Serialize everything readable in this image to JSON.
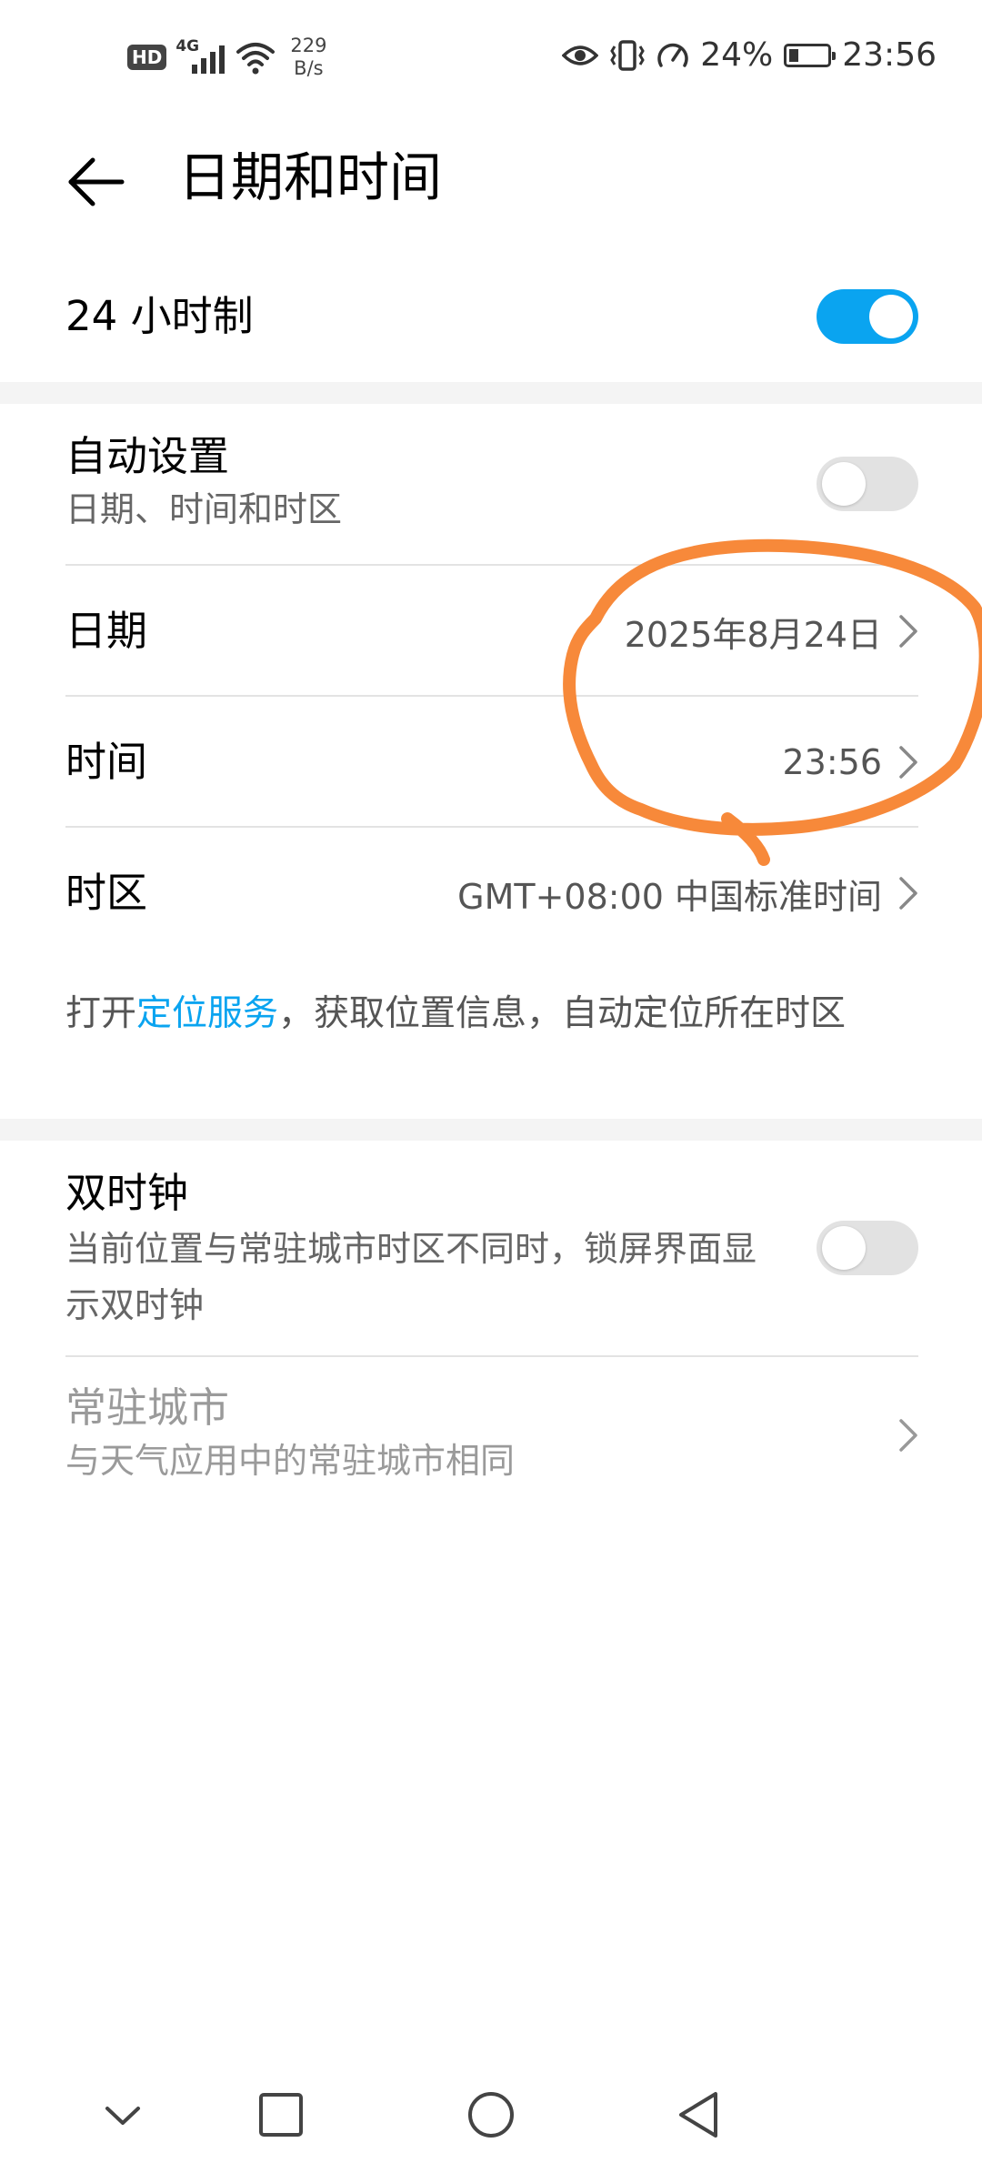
{
  "status_bar": {
    "hd": "HD",
    "network": "4G",
    "speed_value": "229",
    "speed_unit": "B/s",
    "battery_text": "24%",
    "battery_level": 0.24,
    "time": "23:56",
    "icons": [
      "eye-icon",
      "vibrate-icon",
      "speed-icon"
    ]
  },
  "header": {
    "title": "日期和时间"
  },
  "settings": {
    "hour24": {
      "label": "24 小时制",
      "enabled": true
    },
    "auto": {
      "label": "自动设置",
      "sub": "日期、时间和时区",
      "enabled": false
    },
    "date": {
      "label": "日期",
      "value": "2025年8月24日"
    },
    "time": {
      "label": "时间",
      "value": "23:56"
    },
    "timezone": {
      "label": "时区",
      "value": "GMT+08:00 中国标准时间"
    },
    "location_note": {
      "prefix": "打开",
      "link": "定位服务",
      "suffix": "，获取位置信息，自动定位所在时区"
    },
    "dual_clock": {
      "label": "双时钟",
      "sub": "当前位置与常驻城市时区不同时，锁屏界面显示双时钟",
      "enabled": false
    },
    "home_city": {
      "label": "常驻城市",
      "sub": "与天气应用中的常驻城市相同"
    }
  },
  "annotation": {
    "color": "#f7893a"
  },
  "colors": {
    "accent": "#0aa4f0"
  },
  "navbar": [
    "chevron-down-icon",
    "recents-icon",
    "home-icon",
    "back-icon"
  ]
}
